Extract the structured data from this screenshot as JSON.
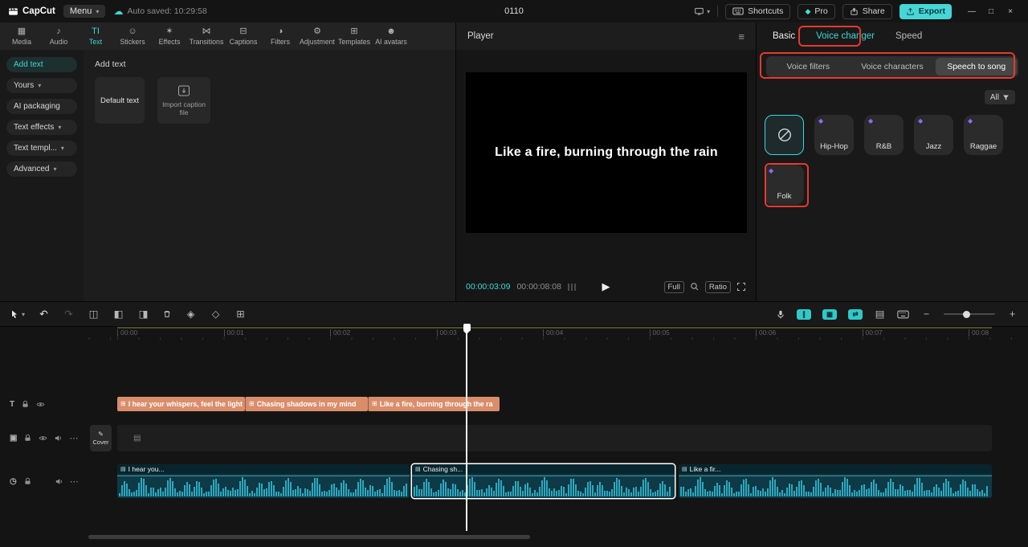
{
  "colors": {
    "accent": "#3fd6d6",
    "annotation": "#e8392e",
    "text_clip": "#d98d6b",
    "audio_clip": "#0d3a46",
    "export_button": "#46d6d6"
  },
  "titlebar": {
    "logo": "CapCut",
    "menu_label": "Menu",
    "autosave_text": "Auto saved: 10:29:58",
    "project_title": "0110",
    "shortcuts_label": "Shortcuts",
    "pro_label": "Pro",
    "share_label": "Share",
    "export_label": "Export",
    "window": {
      "minimize": "—",
      "maximize": "□",
      "close": "×"
    }
  },
  "media_panel": {
    "tabs": [
      {
        "label": "Media",
        "glyph": "▦"
      },
      {
        "label": "Audio",
        "glyph": "♪"
      },
      {
        "label": "Text",
        "glyph": "TI"
      },
      {
        "label": "Stickers",
        "glyph": "☺"
      },
      {
        "label": "Effects",
        "glyph": "✶"
      },
      {
        "label": "Transitions",
        "glyph": "⋈"
      },
      {
        "label": "Captions",
        "glyph": "⊟"
      },
      {
        "label": "Filters",
        "glyph": "◑"
      },
      {
        "label": "Adjustment",
        "glyph": "⚙"
      },
      {
        "label": "Templates",
        "glyph": "⊞"
      },
      {
        "label": "AI avatars",
        "glyph": "☻"
      }
    ],
    "sidebar": [
      {
        "label": "Add text",
        "chevron": ""
      },
      {
        "label": "Yours",
        "chevron": "▾"
      },
      {
        "label": "AI packaging",
        "chevron": ""
      },
      {
        "label": "Text effects",
        "chevron": "▾"
      },
      {
        "label": "Text templ...",
        "chevron": "▾"
      },
      {
        "label": "Advanced",
        "chevron": "▾"
      }
    ],
    "section_title": "Add text",
    "default_text_card": "Default text",
    "import_card": "Import caption file"
  },
  "player": {
    "title": "Player",
    "caption": "Like a fire, burning through the rain",
    "current_time": "00:00:03:09",
    "total_time": "00:00:08:08",
    "full_label": "Full",
    "ratio_label": "Ratio"
  },
  "inspector": {
    "tabs": [
      {
        "label": "Basic"
      },
      {
        "label": "Voice changer"
      },
      {
        "label": "Speed"
      }
    ],
    "segments": [
      {
        "label": "Voice filters"
      },
      {
        "label": "Voice characters"
      },
      {
        "label": "Speech to song"
      }
    ],
    "filter_all_label": "All",
    "voices": [
      {
        "label": ""
      },
      {
        "label": "Hip-Hop"
      },
      {
        "label": "R&B"
      },
      {
        "label": "Jazz"
      },
      {
        "label": "Raggae"
      },
      {
        "label": "Folk"
      }
    ]
  },
  "timeline": {
    "ruler": [
      "00:00",
      "00:01",
      "00:02",
      "00:03",
      "00:04",
      "00:05",
      "00:06",
      "00:07",
      "00:08"
    ],
    "text_clips": [
      {
        "label": "I hear your whispers, feel the light"
      },
      {
        "label": "Chasing shadows in my mind"
      },
      {
        "label": "Like a fire, burning through the ra"
      }
    ],
    "cover_label": "Cover",
    "audio_clips": [
      {
        "label": "I hear you..."
      },
      {
        "label": "Chasing sh..."
      },
      {
        "label": "Like a fir..."
      }
    ]
  }
}
